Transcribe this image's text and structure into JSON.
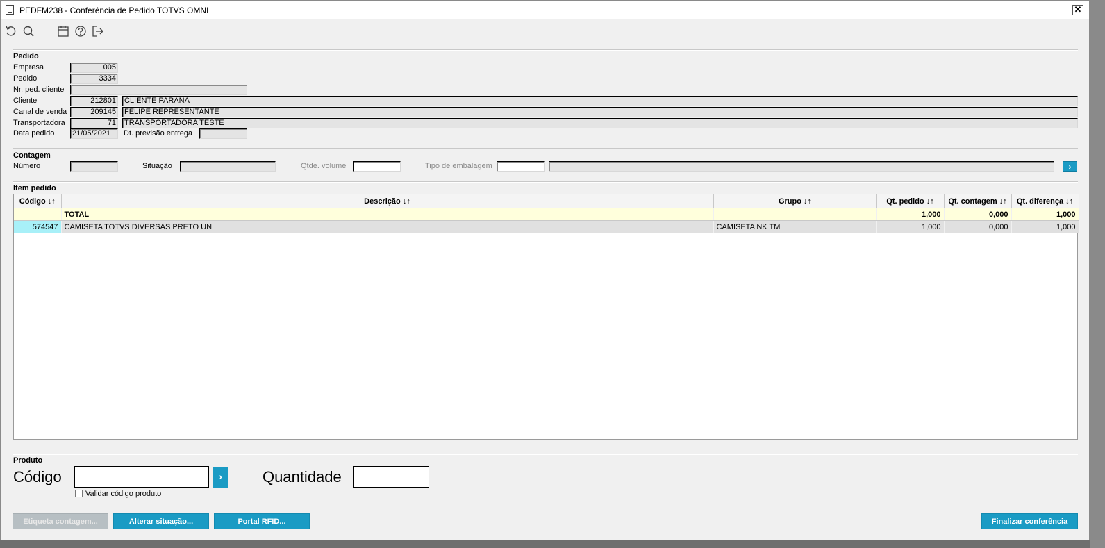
{
  "window": {
    "title": "PEDFM238 - Conferência de Pedido TOTVS OMNI",
    "close_label": "✕"
  },
  "toolbar": {
    "icons": [
      "undo-icon",
      "search-icon",
      "calendar-icon",
      "help-icon",
      "exit-icon"
    ]
  },
  "pedido": {
    "section": "Pedido",
    "empresa_label": "Empresa",
    "empresa": "005",
    "pedido_label": "Pedido",
    "pedido": "3334",
    "nr_ped_cliente_label": "Nr. ped. cliente",
    "nr_ped_cliente": "",
    "cliente_label": "Cliente",
    "cliente_code": "212801",
    "cliente_name": "CLIENTE PARANA",
    "canal_label": "Canal de venda",
    "canal_code": "209145",
    "canal_name": "FELIPE REPRESENTANTE",
    "transportadora_label": "Transportadora",
    "transportadora_code": "71",
    "transportadora_name": "TRANSPORTADORA TESTE",
    "data_pedido_label": "Data pedido",
    "data_pedido": "21/05/2021",
    "dt_previsao_label": "Dt. previsão entrega",
    "dt_previsao": ""
  },
  "contagem": {
    "section": "Contagem",
    "numero_label": "Número",
    "numero": "",
    "situacao_label": "Situação",
    "situacao": "",
    "qtde_volume_label": "Qtde. volume",
    "qtde_volume": "",
    "tipo_embalagem_label": "Tipo de embalagem",
    "tipo_embalagem_code": "",
    "tipo_embalagem_desc": "",
    "go_label": "›"
  },
  "itens": {
    "section": "Item pedido",
    "columns": [
      "Código ↓↑",
      "Descrição ↓↑",
      "Grupo ↓↑",
      "Qt. pedido ↓↑",
      "Qt. contagem ↓↑",
      "Qt. diferença ↓↑"
    ],
    "total": {
      "label": "TOTAL",
      "qt_pedido": "1,000",
      "qt_contagem": "0,000",
      "qt_diferenca": "1,000"
    },
    "rows": [
      {
        "codigo": "574547",
        "descricao": "CAMISETA TOTVS DIVERSAS PRETO UN",
        "grupo": "CAMISETA NK TM",
        "qt_pedido": "1,000",
        "qt_contagem": "0,000",
        "qt_diferenca": "1,000"
      }
    ]
  },
  "produto": {
    "section": "Produto",
    "codigo_label": "Código",
    "codigo": "",
    "go_label": "›",
    "quantidade_label": "Quantidade",
    "quantidade": "",
    "validar_label": "Validar código produto"
  },
  "buttons": {
    "etiqueta": "Etiqueta contagem...",
    "alterar": "Alterar situação...",
    "portal": "Portal RFID...",
    "finalizar": "Finalizar conferência"
  }
}
